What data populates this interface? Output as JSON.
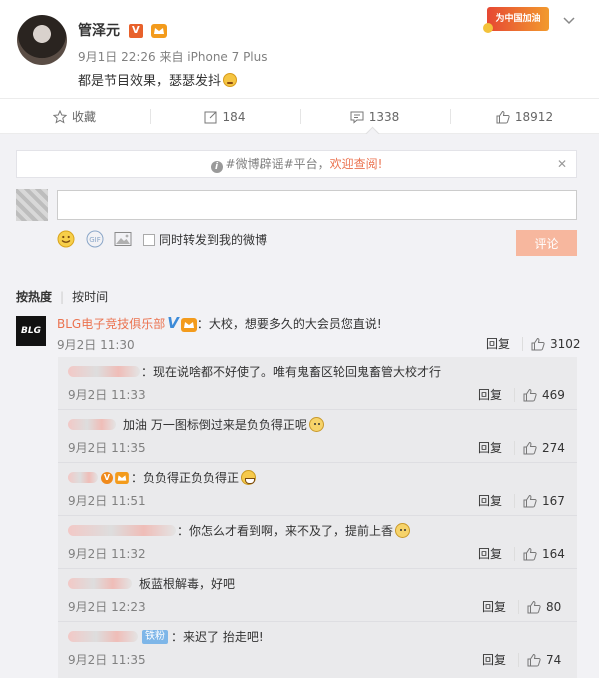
{
  "post": {
    "author": "管泽元",
    "meta": "9月1日 22:26 来自 iPhone 7 Plus",
    "text": "都是节目效果，瑟瑟发抖",
    "banner": "为中国加油"
  },
  "actions": [
    {
      "icon": "star-icon",
      "label": "收藏"
    },
    {
      "icon": "share-icon",
      "label": "184"
    },
    {
      "icon": "comment-icon",
      "label": "1338"
    },
    {
      "icon": "like-icon",
      "label": "18912"
    }
  ],
  "comment_box": {
    "notice_prefix": "#微博辟谣#平台，",
    "notice_link": "欢迎查阅!",
    "notice_close": "✕",
    "placeholder": "",
    "forward_label": "同时转发到我的微博",
    "submit_label": "评论"
  },
  "sort": {
    "hot": "按热度",
    "time": "按时间"
  },
  "main_comment": {
    "avatar_text": "BLG",
    "author": "BLG电子竞技俱乐部",
    "text": "：大校，想要多久的大会员您直说!",
    "time": "9月2日 11:30",
    "reply": "回复",
    "likes": "3102"
  },
  "replies": [
    {
      "text": "：现在说啥都不好使了。唯有鬼畜区轮回鬼畜管大校才行",
      "time": "9月2日 11:33",
      "reply": "回复",
      "likes": "469"
    },
    {
      "text": "加油 万一图标倒过来是负负得正呢",
      "time": "9月2日 11:35",
      "reply": "回复",
      "likes": "274"
    },
    {
      "text": "：负负得正负负得正",
      "time": "9月2日 11:51",
      "reply": "回复",
      "likes": "167"
    },
    {
      "text": "：你怎么才看到啊，来不及了，提前上香",
      "time": "9月2日 11:32",
      "reply": "回复",
      "likes": "164"
    },
    {
      "text": "板蓝根解毒，好吧",
      "time": "9月2日 12:23",
      "reply": "回复",
      "likes": "80"
    },
    {
      "badge": "铁粉",
      "text": "：来迟了 抬走吧!",
      "time": "9月2日 11:35",
      "reply": "回复",
      "likes": "74"
    }
  ]
}
